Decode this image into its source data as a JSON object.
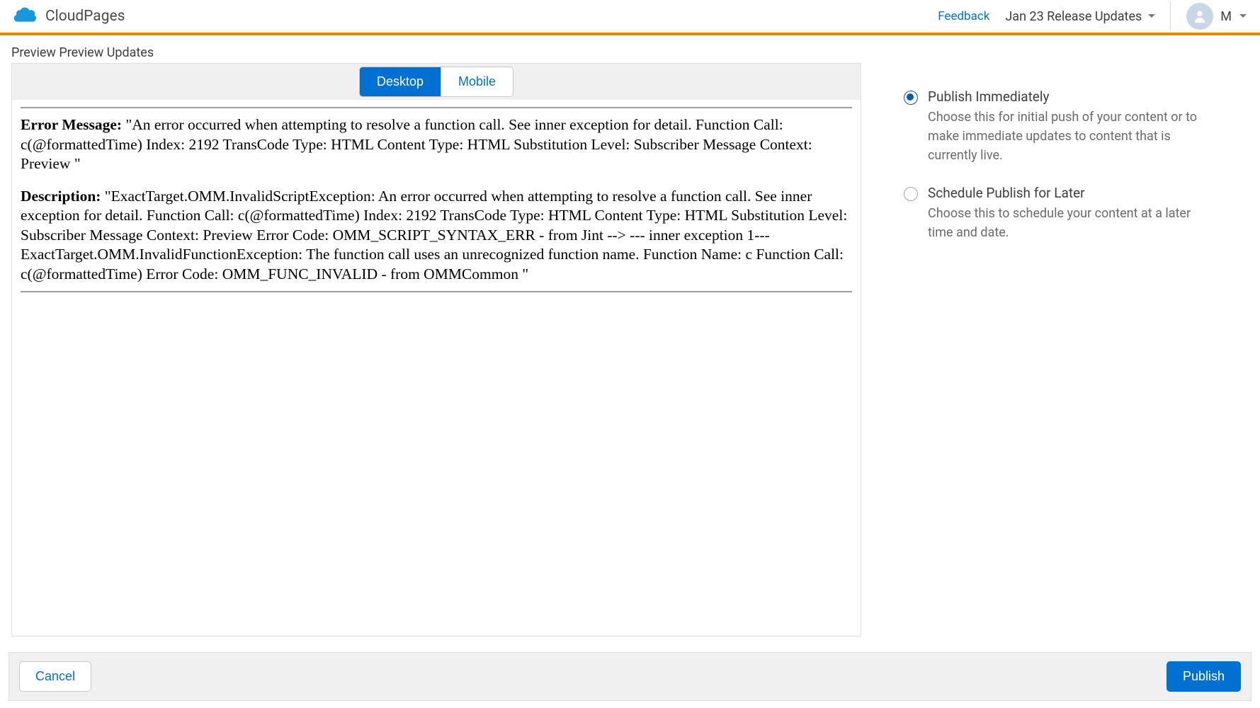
{
  "header": {
    "app_title": "CloudPages",
    "feedback_label": "Feedback",
    "release_updates_label": "Jan 23 Release Updates",
    "user_initial": "M"
  },
  "breadcrumb": "Preview Preview Updates",
  "toggle": {
    "desktop_label": "Desktop",
    "mobile_label": "Mobile"
  },
  "preview": {
    "error_label": "Error Message:",
    "error_text": "\"An error occurred when attempting to resolve a function call. See inner exception for detail. Function Call: c(@formattedTime) Index: 2192 TransCode Type: HTML Content Type: HTML Substitution Level: Subscriber Message Context: Preview \"",
    "desc_label": "Description:",
    "desc_text": "\"ExactTarget.OMM.InvalidScriptException: An error occurred when attempting to resolve a function call. See inner exception for detail. Function Call: c(@formattedTime) Index: 2192 TransCode Type: HTML Content Type: HTML Substitution Level: Subscriber Message Context: Preview Error Code: OMM_SCRIPT_SYNTAX_ERR - from Jint --> --- inner exception 1--- ExactTarget.OMM.InvalidFunctionException: The function call uses an unrecognized function name. Function Name: c Function Call: c(@formattedTime) Error Code: OMM_FUNC_INVALID - from OMMCommon \""
  },
  "publish_options": {
    "immediate": {
      "title": "Publish Immediately",
      "desc": "Choose this for initial push of your content or to make immediate updates to content that is currently live."
    },
    "schedule": {
      "title": "Schedule Publish for Later",
      "desc": "Choose this to schedule your content at a later time and date."
    }
  },
  "footer": {
    "cancel_label": "Cancel",
    "publish_label": "Publish"
  }
}
